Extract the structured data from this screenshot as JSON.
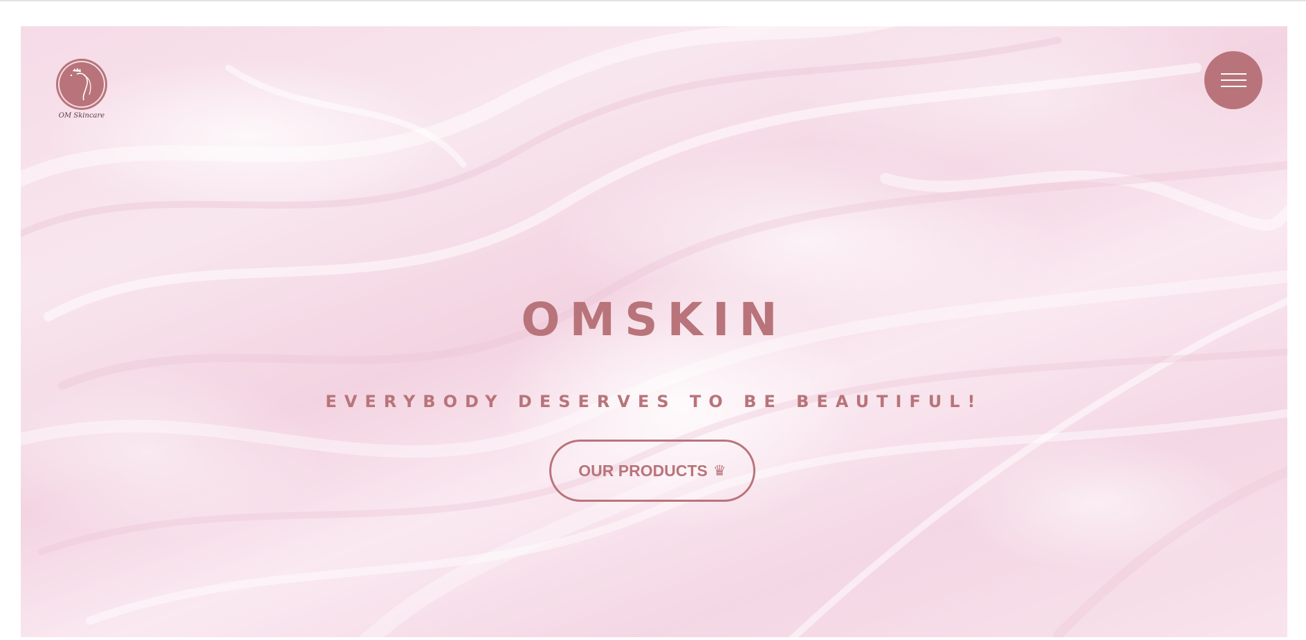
{
  "brand": {
    "name": "OMSKIN",
    "tagline": "EVERYBODY DESERVES TO BE BEAUTIFUL!",
    "logo_text": "OM Skincare",
    "logo_icon": "woman-crown-logo",
    "accent_color": "#b8747a"
  },
  "nav": {
    "menu_icon": "hamburger-menu-icon"
  },
  "hero": {
    "cta_label": "OUR PRODUCTS",
    "cta_icon_glyph": "♛",
    "cta_icon": "crown-icon"
  }
}
